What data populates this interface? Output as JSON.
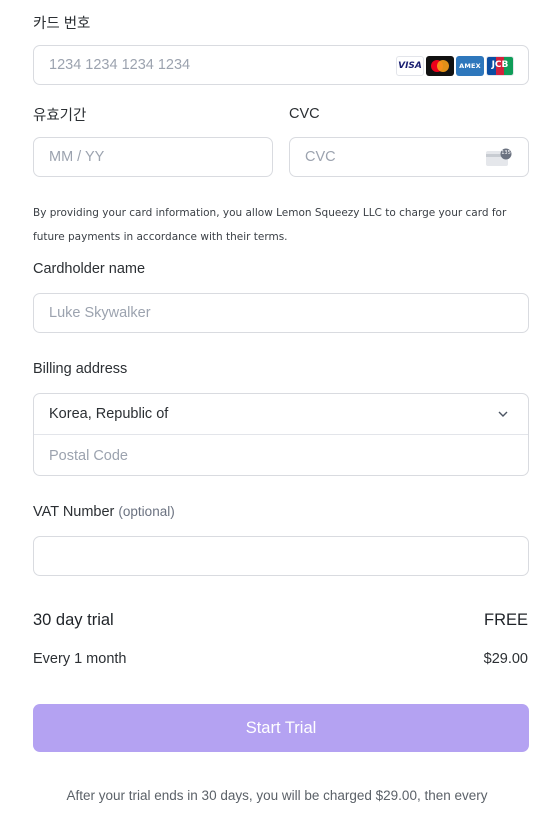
{
  "card": {
    "label": "카드 번호",
    "placeholder": "1234 1234 1234 1234",
    "brands": [
      "VISA",
      "Mastercard",
      "AMEX",
      "JCB"
    ],
    "brand_colors": {
      "visa": "#1a1f71",
      "mastercard_red": "#eb001b",
      "mastercard_orange": "#f79e1b",
      "amex": "#2e77bc",
      "jcb_blue": "#0b4ea2",
      "jcb_red": "#d3203c",
      "jcb_green": "#0f9d58"
    }
  },
  "expiry": {
    "label": "유효기간",
    "placeholder": "MM / YY"
  },
  "cvc": {
    "label": "CVC",
    "placeholder": "CVC",
    "icon": "cvc-card-icon",
    "icon_text": "135"
  },
  "notice": "By providing your card information, you allow Lemon Squeezy LLC to charge your card for future payments in accordance with their terms.",
  "cardholder": {
    "label": "Cardholder name",
    "placeholder": "Luke Skywalker"
  },
  "billing": {
    "label": "Billing address",
    "country": "Korea, Republic of",
    "postal_placeholder": "Postal Code"
  },
  "vat": {
    "label": "VAT Number",
    "optional": "(optional)",
    "value": ""
  },
  "summary": {
    "trial_label": "30 day trial",
    "trial_price": "FREE",
    "period_label": "Every 1 month",
    "period_price": "$29.00"
  },
  "cta": {
    "label": "Start Trial",
    "color": "#b4a2f2"
  },
  "footer": "After your trial ends in 30 days, you will be charged $29.00, then every"
}
